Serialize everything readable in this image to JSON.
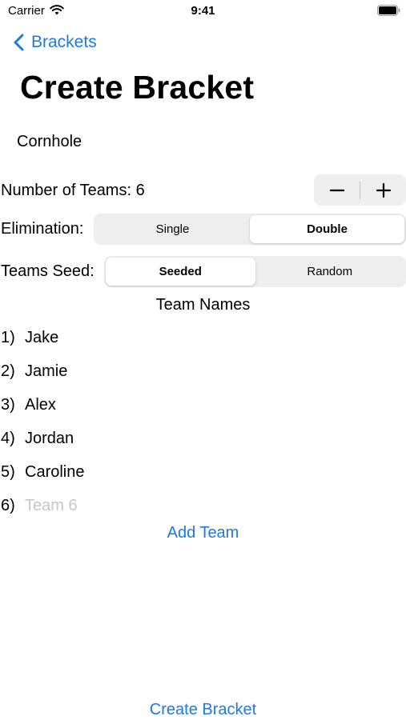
{
  "status_bar": {
    "carrier": "Carrier",
    "time": "9:41"
  },
  "nav": {
    "back_label": "Brackets",
    "title": "Create Bracket"
  },
  "game_name": "Cornhole",
  "teams_count": {
    "label": "Number of Teams: 6"
  },
  "elimination": {
    "label": "Elimination:",
    "options": [
      "Single",
      "Double"
    ],
    "selected": "Double"
  },
  "seed": {
    "label": "Teams Seed:",
    "options": [
      "Seeded",
      "Random"
    ],
    "selected": "Seeded"
  },
  "team_names": {
    "title": "Team Names",
    "teams": [
      {
        "number": "1)",
        "value": "Jake",
        "placeholder": ""
      },
      {
        "number": "2)",
        "value": "Jamie",
        "placeholder": ""
      },
      {
        "number": "3)",
        "value": "Alex",
        "placeholder": ""
      },
      {
        "number": "4)",
        "value": "Jordan",
        "placeholder": ""
      },
      {
        "number": "5)",
        "value": "Caroline",
        "placeholder": ""
      },
      {
        "number": "6)",
        "value": "",
        "placeholder": "Team 6"
      }
    ]
  },
  "add_team_label": "Add Team",
  "create_bracket_label": "Create Bracket",
  "colors": {
    "accent": "#1f7ae0",
    "segment_bg": "#eeeeef",
    "placeholder": "#c6c6c8"
  },
  "icons": [
    "wifi-icon",
    "battery-icon",
    "chevron-left-icon",
    "minus-icon",
    "plus-icon"
  ]
}
